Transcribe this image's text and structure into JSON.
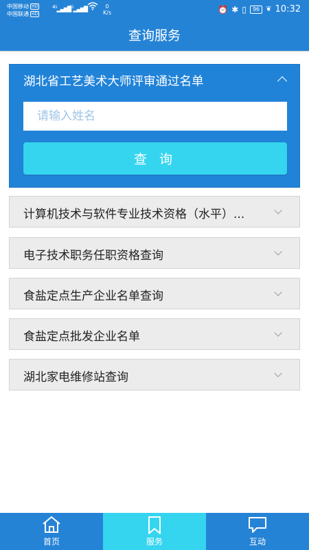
{
  "status_bar": {
    "carrier1": "中国移动",
    "carrier2": "中国联通",
    "hd": "HD",
    "net1": "4G",
    "net2": "4G",
    "speed_value": "0",
    "speed_unit": "K/s",
    "battery": "96",
    "time": "10:32"
  },
  "header": {
    "title": "查询服务"
  },
  "panel": {
    "title": "湖北省工艺美术大师评审通过名单",
    "input_placeholder": "请输入姓名",
    "input_value": "",
    "button_label": "查 询"
  },
  "items": [
    {
      "label": "计算机技术与软件专业技术资格（水平）..."
    },
    {
      "label": "电子技术职务任职资格查询"
    },
    {
      "label": "食盐定点生产企业名单查询"
    },
    {
      "label": "食盐定点批发企业名单"
    },
    {
      "label": "湖北家电维修站查询"
    }
  ],
  "nav": {
    "items": [
      {
        "label": "首页",
        "icon": "home-icon",
        "active": false
      },
      {
        "label": "服务",
        "icon": "bookmark-icon",
        "active": true
      },
      {
        "label": "互动",
        "icon": "chat-icon",
        "active": false
      }
    ]
  },
  "colors": {
    "primary": "#2583d6",
    "accent": "#35d5ef",
    "item_bg": "#ececec"
  }
}
